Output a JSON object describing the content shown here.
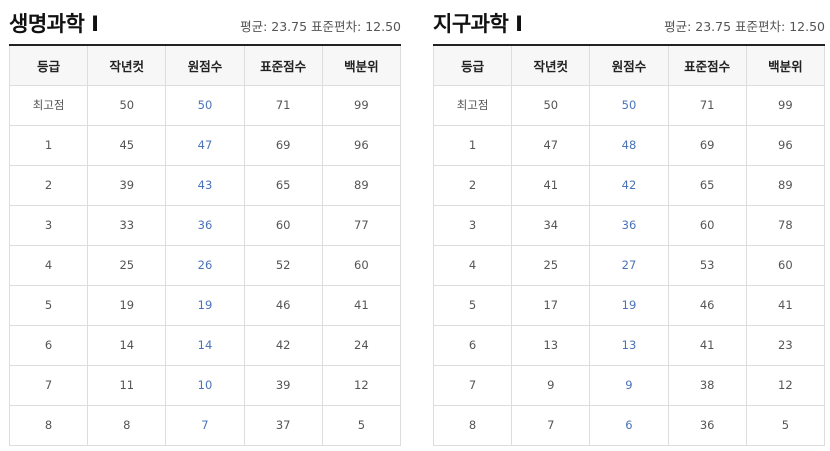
{
  "tables": [
    {
      "title": "생명과학 Ⅰ",
      "stats": "평균: 23.75 표준편차: 12.50",
      "headers": [
        "등급",
        "작년컷",
        "원점수",
        "표준점수",
        "백분위"
      ],
      "rows": [
        [
          "최고점",
          "50",
          "50",
          "71",
          "99"
        ],
        [
          "1",
          "45",
          "47",
          "69",
          "96"
        ],
        [
          "2",
          "39",
          "43",
          "65",
          "89"
        ],
        [
          "3",
          "33",
          "36",
          "60",
          "77"
        ],
        [
          "4",
          "25",
          "26",
          "52",
          "60"
        ],
        [
          "5",
          "19",
          "19",
          "46",
          "41"
        ],
        [
          "6",
          "14",
          "14",
          "42",
          "24"
        ],
        [
          "7",
          "11",
          "10",
          "39",
          "12"
        ],
        [
          "8",
          "8",
          "7",
          "37",
          "5"
        ]
      ]
    },
    {
      "title": "지구과학 Ⅰ",
      "stats": "평균: 23.75 표준편차: 12.50",
      "headers": [
        "등급",
        "작년컷",
        "원점수",
        "표준점수",
        "백분위"
      ],
      "rows": [
        [
          "최고점",
          "50",
          "50",
          "71",
          "99"
        ],
        [
          "1",
          "47",
          "48",
          "69",
          "96"
        ],
        [
          "2",
          "41",
          "42",
          "65",
          "89"
        ],
        [
          "3",
          "34",
          "36",
          "60",
          "78"
        ],
        [
          "4",
          "25",
          "27",
          "53",
          "60"
        ],
        [
          "5",
          "17",
          "19",
          "46",
          "41"
        ],
        [
          "6",
          "13",
          "13",
          "41",
          "23"
        ],
        [
          "7",
          "9",
          "9",
          "38",
          "12"
        ],
        [
          "8",
          "7",
          "6",
          "36",
          "5"
        ]
      ]
    }
  ],
  "colors": {
    "raw_score": "#4a72b8",
    "header_bg": "#f7f7f7",
    "border": "#dddddd",
    "top_rule": "#222222"
  }
}
